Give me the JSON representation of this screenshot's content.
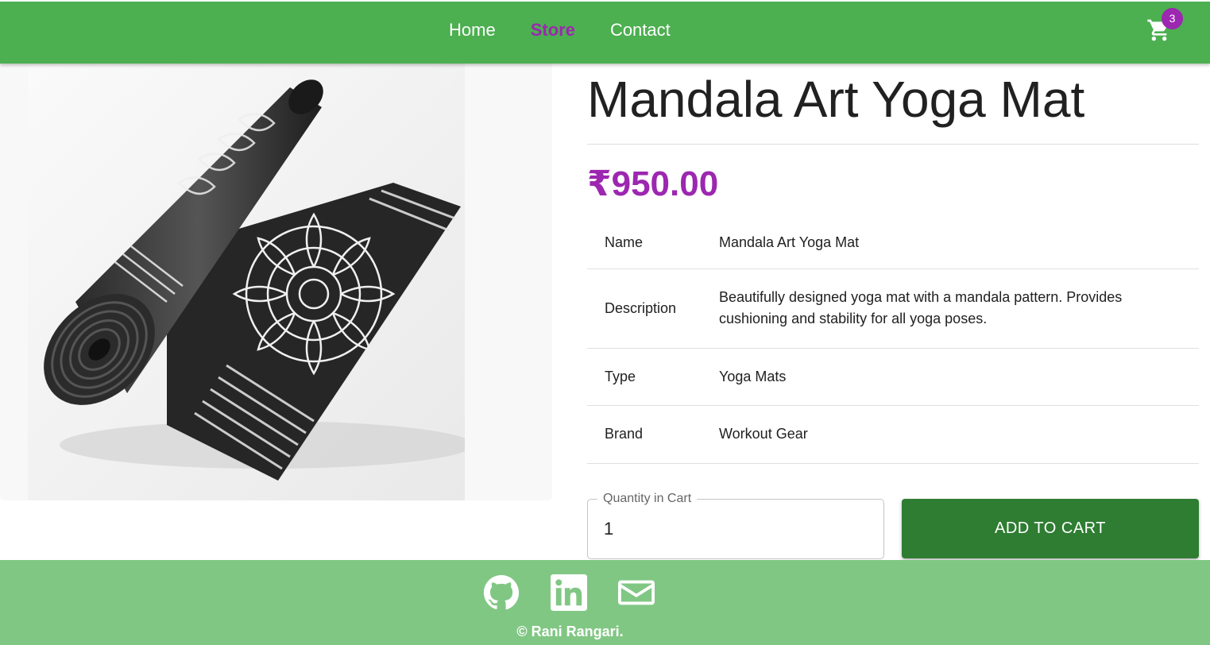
{
  "nav": {
    "links": [
      {
        "label": "Home",
        "active": false
      },
      {
        "label": "Store",
        "active": true
      },
      {
        "label": "Contact",
        "active": false
      }
    ],
    "cart_icon": "shopping-cart-icon",
    "cart_count": "3"
  },
  "product": {
    "title": "Mandala Art Yoga Mat",
    "price": "₹950.00",
    "image_icon": "yoga-mat-image",
    "specs": [
      {
        "key": "Name",
        "value": "Mandala Art Yoga Mat"
      },
      {
        "key": "Description",
        "value": "Beautifully designed yoga mat with a mandala pattern. Provides cushioning and stability for all yoga poses."
      },
      {
        "key": "Type",
        "value": "Yoga Mats"
      },
      {
        "key": "Brand",
        "value": "Workout Gear"
      }
    ]
  },
  "cart_form": {
    "quantity_label": "Quantity in Cart",
    "quantity_value": "1",
    "add_button": "ADD TO CART"
  },
  "footer": {
    "social_icons": [
      "github-icon",
      "linkedin-icon",
      "email-icon"
    ],
    "copyright": "© Rani Rangari."
  },
  "colors": {
    "primary_green": "#4caf50",
    "dark_green": "#2e7d32",
    "light_green": "#81c784",
    "accent_purple": "#9c27b0"
  }
}
